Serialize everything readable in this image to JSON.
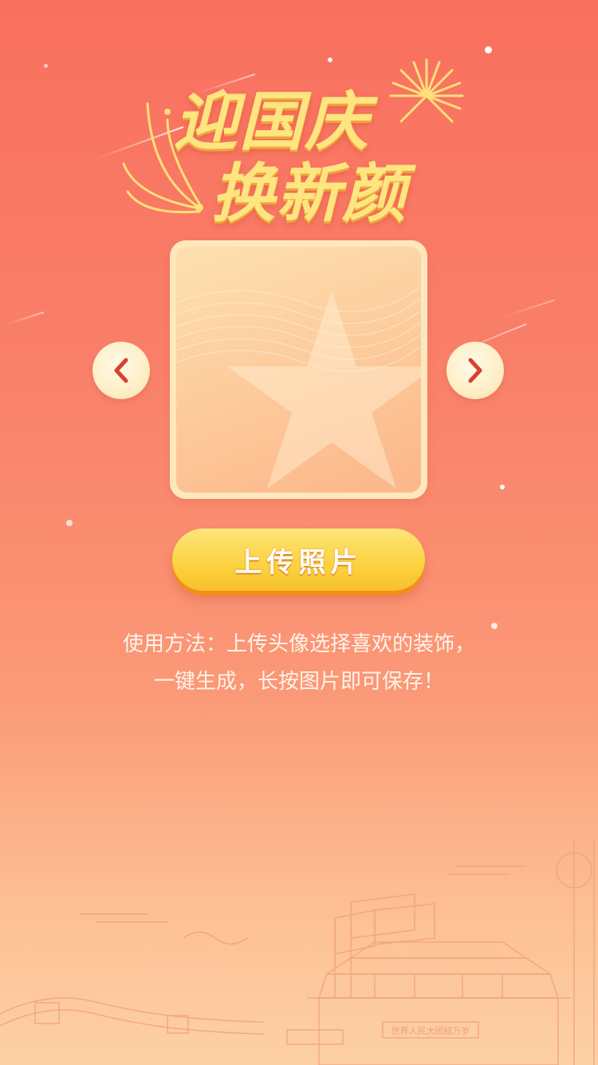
{
  "header": {
    "title_line1": "迎国庆",
    "title_line2": "换新颜"
  },
  "carousel": {
    "prev_icon": "chevron-left-icon",
    "next_icon": "chevron-right-icon",
    "frame_motif": "star-icon"
  },
  "actions": {
    "upload_label": "上传照片"
  },
  "instructions": {
    "line1": "使用方法：上传头像选择喜欢的装饰，",
    "line2": "一键生成，长按图片即可保存！"
  },
  "illustration": {
    "banner_text": "世界人民大团结万岁",
    "subject": "tiananmen-great-wall-illustration"
  },
  "colors": {
    "accent_gold": "#fde580",
    "button_yellow": "#fbd23e",
    "arrow_red": "#d8402f",
    "background_top": "#f9705f",
    "background_bottom": "#fdd0a6"
  }
}
